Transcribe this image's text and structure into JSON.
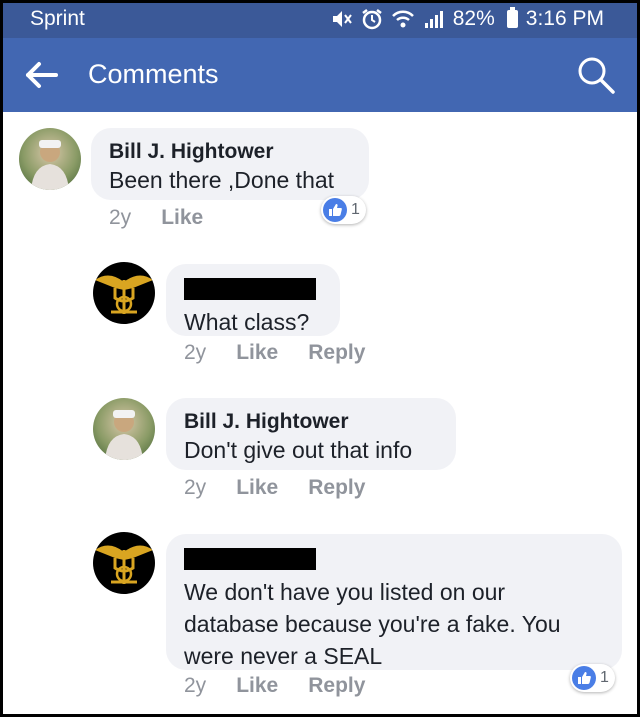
{
  "status_bar": {
    "carrier": "Sprint",
    "battery_percent": "82%",
    "time": "3:16 PM"
  },
  "header": {
    "title": "Comments",
    "back_icon": "back-arrow-icon",
    "search_icon": "search-icon"
  },
  "comments": [
    {
      "author": "Bill J. Hightower",
      "text": "Been there ,Done that",
      "time": "2y",
      "like_label": "Like",
      "reply_label": "",
      "like_count": "1",
      "avatar": "profile-photo"
    },
    {
      "author": "",
      "text": "What class?",
      "time": "2y",
      "like_label": "Like",
      "reply_label": "Reply",
      "avatar": "navy-seal-trident-logo"
    },
    {
      "author": "Bill J. Hightower",
      "text": "Don't give out that info",
      "time": "2y",
      "like_label": "Like",
      "reply_label": "Reply",
      "avatar": "profile-photo"
    },
    {
      "author": "",
      "text_lines": [
        "We don't have you listed on our",
        "database because you're a fake.  You",
        "were never a SEAL"
      ],
      "time": "2y",
      "like_label": "Like",
      "reply_label": "Reply",
      "like_count": "1",
      "avatar": "navy-seal-trident-logo"
    }
  ],
  "colors": {
    "status_bar": "#3b5998",
    "header": "#4267b2",
    "bubble": "#f1f2f6",
    "meta_text": "#90949c",
    "like_blue": "#4a7ee6"
  }
}
